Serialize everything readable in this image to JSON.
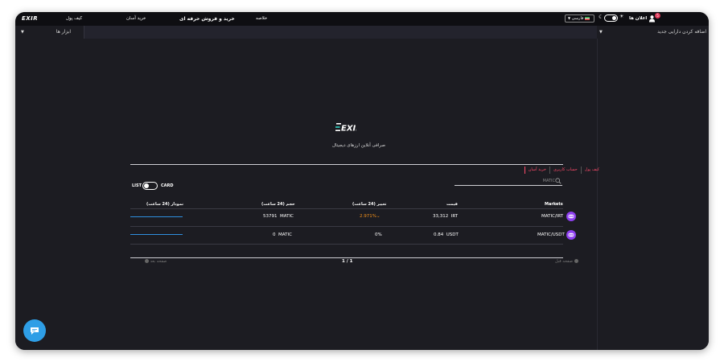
{
  "header": {
    "logo": "EXIR",
    "nav": {
      "wallet": "کیف پول",
      "quick_buy": "خرید آسان",
      "pro_trade": "خرید و فروش حرفه ای",
      "summary": "خلاصه"
    },
    "language": "فارسی",
    "account": "اعلان ها",
    "notification_count": "5"
  },
  "toolbar": {
    "tools_label": "ابزار ها",
    "add_asset_label": "اضافه کردن دارایی جدید"
  },
  "main": {
    "brand": "EXIR",
    "tagline": "صرافی آنلاین ارزهای دیجیتال",
    "tabs": [
      "خرید آسان",
      "حساب کاربری",
      "کیف پول"
    ],
    "search_placeholder": "MATIC",
    "view_toggle": {
      "list": "LIST",
      "card": "CARD"
    },
    "table": {
      "headers": {
        "markets": "Markets",
        "price": "قیمت",
        "change": "تغییر (24 ساعت)",
        "volume": "حجم (24 ساعت)",
        "chart": "نمودار (24 ساعت)"
      },
      "rows": [
        {
          "pair": "MATIC/IRT",
          "price": "33,312",
          "price_unit": "IRT",
          "change": "2.971%",
          "change_color": "#f7931a",
          "volume": "53791",
          "volume_unit": "MATIC"
        },
        {
          "pair": "MATIC/USDT",
          "price": "0.84",
          "price_unit": "USDT",
          "change": "0%",
          "change_color": "#ffffff",
          "volume": "0",
          "volume_unit": "MATIC"
        }
      ]
    },
    "pagination": {
      "previous": "صفحه قبل",
      "next": "صفحه بعد",
      "page_indicator": "1 / 1"
    }
  },
  "colors": {
    "accent": "#ff4b6b",
    "spark": "#2f8fe0",
    "coin": "#8e3ff0",
    "chat": "#2e9ee6",
    "background": "#1c1c22"
  }
}
